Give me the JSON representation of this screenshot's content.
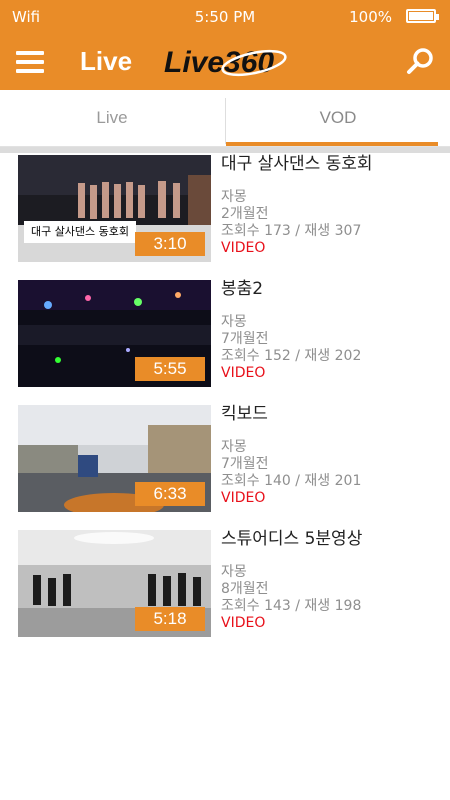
{
  "status_bar": {
    "network": "Wifi",
    "time": "5:50 PM",
    "battery": "100%"
  },
  "app_bar": {
    "title": "Live",
    "logo_text": "Live360"
  },
  "tabs": [
    {
      "label": "Live",
      "selected": false
    },
    {
      "label": "VOD",
      "selected": true
    }
  ],
  "colors": {
    "accent": "#e98c28",
    "video_label": "#e8101a"
  },
  "videos": [
    {
      "title": "대구 살사댄스 동호회",
      "duration": "3:10",
      "thumbnail_caption": "대구 살사댄스 동호회",
      "uploader": "자몽",
      "age": "2개월전",
      "stats": "조회수 173 / 재생 307",
      "type": "VIDEO"
    },
    {
      "title": "봉춤2",
      "duration": "5:55",
      "uploader": "자몽",
      "age": "7개월전",
      "stats": "조회수 152 / 재생 202",
      "type": "VIDEO"
    },
    {
      "title": "킥보드",
      "duration": "6:33",
      "uploader": "자몽",
      "age": "7개월전",
      "stats": "조회수 140 / 재생 201",
      "type": "VIDEO"
    },
    {
      "title": "스튜어디스 5분영상",
      "duration": "5:18",
      "uploader": "자몽",
      "age": "8개월전",
      "stats": "조회수 143 / 재생 198",
      "type": "VIDEO"
    }
  ]
}
